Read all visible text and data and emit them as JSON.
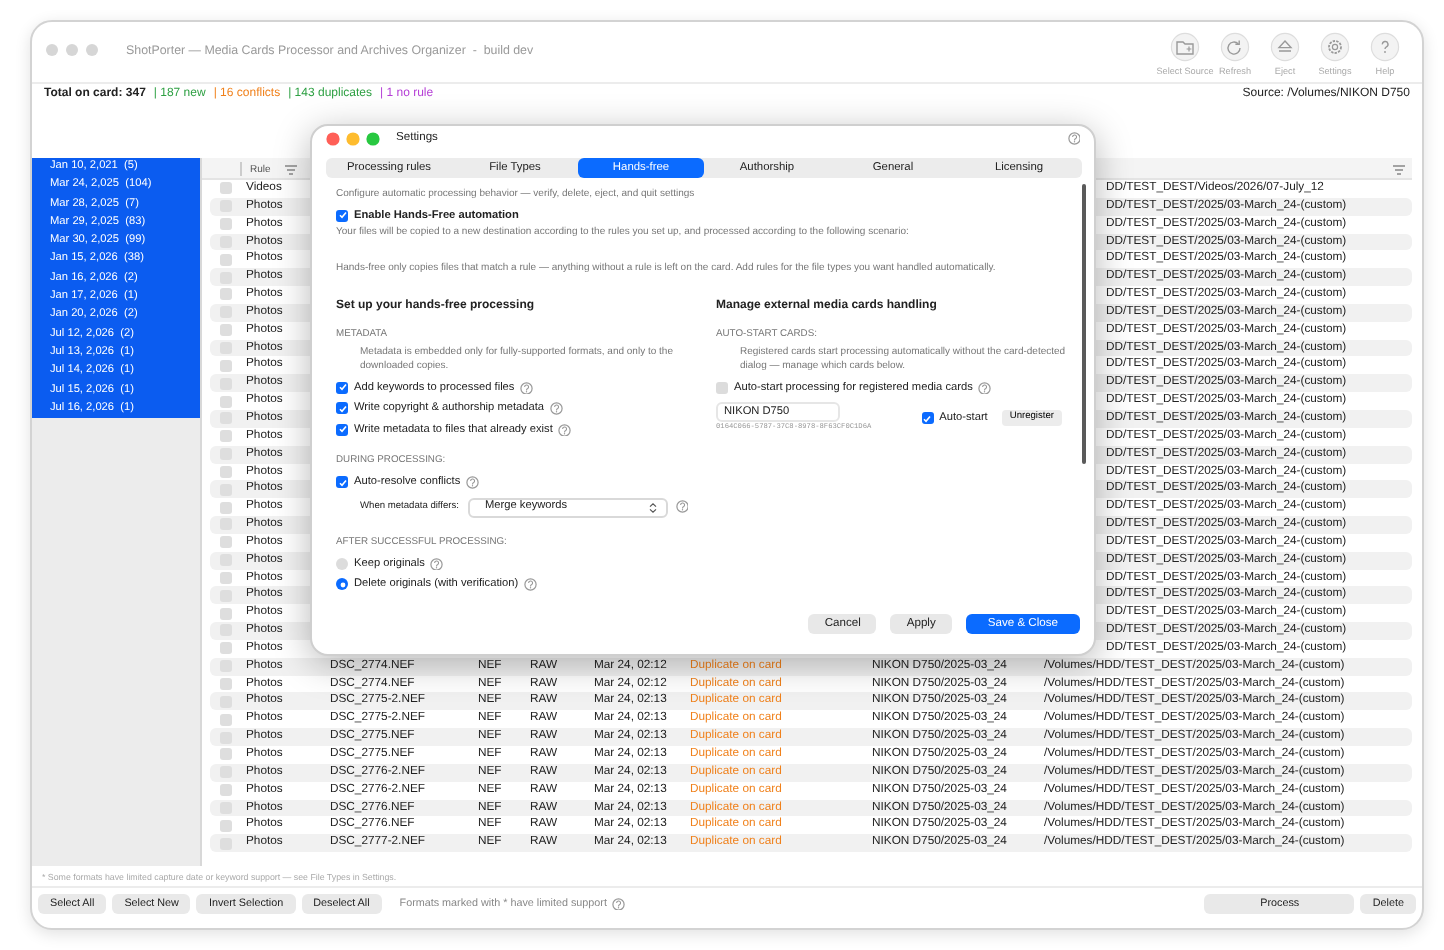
{
  "window": {
    "title": "ShotPorter — Media Cards Processor and Archives Organizer  -  build dev"
  },
  "toolbar": [
    {
      "label": "Select Source"
    },
    {
      "label": "Refresh"
    },
    {
      "label": "Eject"
    },
    {
      "label": "Settings"
    },
    {
      "label": "Help"
    }
  ],
  "summary": {
    "total": "Total on card: 347",
    "counts": [
      {
        "text": "| 187 new",
        "color": "#2ea043"
      },
      {
        "text": "| 16 conflicts",
        "color": "#f0801a"
      },
      {
        "text": "| 143 duplicates",
        "color": "#2ea043"
      },
      {
        "text": "| 1 no rule",
        "color": "#b53fd6"
      }
    ],
    "source": "Source: /Volumes/NIKON D750"
  },
  "sidebar": {
    "items": [
      {
        "label": "Jan 10, 2,021  (5)",
        "selected": true
      },
      {
        "label": "Mar 24, 2,025  (104)",
        "selected": true
      },
      {
        "label": "Mar 28, 2,025  (7)",
        "selected": true
      },
      {
        "label": "Mar 29, 2,025  (83)",
        "selected": true
      },
      {
        "label": "Mar 30, 2,025  (99)",
        "selected": true
      },
      {
        "label": "Jan 15, 2,026  (38)",
        "selected": true
      },
      {
        "label": "Jan 16, 2,026  (2)",
        "selected": true
      },
      {
        "label": "Jan 17, 2,026  (1)",
        "selected": true
      },
      {
        "label": "Jan 20, 2,026  (2)",
        "selected": true
      },
      {
        "label": "Jul 12, 2,026  (2)",
        "selected": true
      },
      {
        "label": "Jul 13, 2,026  (1)",
        "selected": true
      },
      {
        "label": "Jul 14, 2,026  (1)",
        "selected": true
      },
      {
        "label": "Jul 15, 2,026  (1)",
        "selected": true
      },
      {
        "label": "Jul 16, 2,026  (1)",
        "selected": true
      }
    ]
  },
  "table": {
    "columns": [
      {
        "label": "Rule"
      }
    ],
    "rows": [
      {
        "kind": "covered",
        "checked": false,
        "rule": "Videos",
        "destination": "DD/TEST_DEST/Videos/2026/07-July_12"
      },
      {
        "kind": "covered",
        "checked": false,
        "rule": "Photos",
        "destination": "DD/TEST_DEST/2025/03-March_24-(custom)"
      },
      {
        "kind": "covered",
        "checked": false,
        "rule": "Photos",
        "destination": "DD/TEST_DEST/2025/03-March_24-(custom)"
      },
      {
        "kind": "covered",
        "checked": false,
        "rule": "Photos",
        "destination": "DD/TEST_DEST/2025/03-March_24-(custom)"
      },
      {
        "kind": "covered",
        "checked": false,
        "rule": "Photos",
        "destination": "DD/TEST_DEST/2025/03-March_24-(custom)"
      },
      {
        "kind": "covered",
        "checked": false,
        "rule": "Photos",
        "destination": "DD/TEST_DEST/2025/03-March_24-(custom)"
      },
      {
        "kind": "covered",
        "checked": false,
        "rule": "Photos",
        "destination": "DD/TEST_DEST/2025/03-March_24-(custom)"
      },
      {
        "kind": "covered",
        "checked": false,
        "rule": "Photos",
        "destination": "DD/TEST_DEST/2025/03-March_24-(custom)"
      },
      {
        "kind": "covered",
        "checked": false,
        "rule": "Photos",
        "destination": "DD/TEST_DEST/2025/03-March_24-(custom)"
      },
      {
        "kind": "covered",
        "checked": false,
        "rule": "Photos",
        "destination": "DD/TEST_DEST/2025/03-March_24-(custom)"
      },
      {
        "kind": "covered",
        "checked": false,
        "rule": "Photos",
        "destination": "DD/TEST_DEST/2025/03-March_24-(custom)"
      },
      {
        "kind": "covered",
        "checked": false,
        "rule": "Photos",
        "destination": "DD/TEST_DEST/2025/03-March_24-(custom)"
      },
      {
        "kind": "covered",
        "checked": false,
        "rule": "Photos",
        "destination": "DD/TEST_DEST/2025/03-March_24-(custom)"
      },
      {
        "kind": "covered",
        "checked": false,
        "rule": "Photos",
        "destination": "DD/TEST_DEST/2025/03-March_24-(custom)"
      },
      {
        "kind": "covered",
        "checked": false,
        "rule": "Photos",
        "destination": "DD/TEST_DEST/2025/03-March_24-(custom)"
      },
      {
        "kind": "covered",
        "checked": false,
        "rule": "Photos",
        "destination": "DD/TEST_DEST/2025/03-March_24-(custom)"
      },
      {
        "kind": "covered",
        "checked": false,
        "rule": "Photos",
        "destination": "DD/TEST_DEST/2025/03-March_24-(custom)"
      },
      {
        "kind": "covered",
        "checked": false,
        "rule": "Photos",
        "destination": "DD/TEST_DEST/2025/03-March_24-(custom)"
      },
      {
        "kind": "covered",
        "checked": false,
        "rule": "Photos",
        "destination": "DD/TEST_DEST/2025/03-March_24-(custom)"
      },
      {
        "kind": "covered",
        "checked": false,
        "rule": "Photos",
        "destination": "DD/TEST_DEST/2025/03-March_24-(custom)"
      },
      {
        "kind": "covered",
        "checked": false,
        "rule": "Photos",
        "destination": "DD/TEST_DEST/2025/03-March_24-(custom)"
      },
      {
        "kind": "covered",
        "checked": false,
        "rule": "Photos",
        "destination": "DD/TEST_DEST/2025/03-March_24-(custom)"
      },
      {
        "kind": "covered",
        "checked": false,
        "rule": "Photos",
        "destination": "DD/TEST_DEST/2025/03-March_24-(custom)"
      },
      {
        "kind": "covered",
        "checked": false,
        "rule": "Photos",
        "destination": "DD/TEST_DEST/2025/03-March_24-(custom)"
      },
      {
        "kind": "covered",
        "checked": false,
        "rule": "Photos",
        "destination": "DD/TEST_DEST/2025/03-March_24-(custom)"
      },
      {
        "kind": "covered",
        "checked": false,
        "rule": "Photos",
        "destination": "DD/TEST_DEST/2025/03-March_24-(custom)"
      },
      {
        "kind": "covered",
        "checked": false,
        "rule": "Photos",
        "destination": "DD/TEST_DEST/2025/03-March_24-(custom)"
      },
      {
        "kind": "full",
        "checked": false,
        "rule": "Photos",
        "file": "DSC_2774.NEF",
        "ext": "NEF",
        "type": "RAW",
        "date": "Mar 24, 02:12",
        "status": "Duplicate on card",
        "folder": "NIKON D750/2025-03_24",
        "destination": "/Volumes/HDD/TEST_DEST/2025/03-March_24-(custom)"
      },
      {
        "kind": "full",
        "checked": false,
        "rule": "Photos",
        "file": "DSC_2774.NEF",
        "ext": "NEF",
        "type": "RAW",
        "date": "Mar 24, 02:12",
        "status": "Duplicate on card",
        "folder": "NIKON D750/2025-03_24",
        "destination": "/Volumes/HDD/TEST_DEST/2025/03-March_24-(custom)"
      },
      {
        "kind": "full",
        "checked": false,
        "rule": "Photos",
        "file": "DSC_2775-2.NEF",
        "ext": "NEF",
        "type": "RAW",
        "date": "Mar 24, 02:13",
        "status": "Duplicate on card",
        "folder": "NIKON D750/2025-03_24",
        "destination": "/Volumes/HDD/TEST_DEST/2025/03-March_24-(custom)"
      },
      {
        "kind": "full",
        "checked": false,
        "rule": "Photos",
        "file": "DSC_2775-2.NEF",
        "ext": "NEF",
        "type": "RAW",
        "date": "Mar 24, 02:13",
        "status": "Duplicate on card",
        "folder": "NIKON D750/2025-03_24",
        "destination": "/Volumes/HDD/TEST_DEST/2025/03-March_24-(custom)"
      },
      {
        "kind": "full",
        "checked": false,
        "rule": "Photos",
        "file": "DSC_2775.NEF",
        "ext": "NEF",
        "type": "RAW",
        "date": "Mar 24, 02:13",
        "status": "Duplicate on card",
        "folder": "NIKON D750/2025-03_24",
        "destination": "/Volumes/HDD/TEST_DEST/2025/03-March_24-(custom)"
      },
      {
        "kind": "full",
        "checked": false,
        "rule": "Photos",
        "file": "DSC_2775.NEF",
        "ext": "NEF",
        "type": "RAW",
        "date": "Mar 24, 02:13",
        "status": "Duplicate on card",
        "folder": "NIKON D750/2025-03_24",
        "destination": "/Volumes/HDD/TEST_DEST/2025/03-March_24-(custom)"
      },
      {
        "kind": "full",
        "checked": false,
        "rule": "Photos",
        "file": "DSC_2776-2.NEF",
        "ext": "NEF",
        "type": "RAW",
        "date": "Mar 24, 02:13",
        "status": "Duplicate on card",
        "folder": "NIKON D750/2025-03_24",
        "destination": "/Volumes/HDD/TEST_DEST/2025/03-March_24-(custom)"
      },
      {
        "kind": "full",
        "checked": false,
        "rule": "Photos",
        "file": "DSC_2776-2.NEF",
        "ext": "NEF",
        "type": "RAW",
        "date": "Mar 24, 02:13",
        "status": "Duplicate on card",
        "folder": "NIKON D750/2025-03_24",
        "destination": "/Volumes/HDD/TEST_DEST/2025/03-March_24-(custom)"
      },
      {
        "kind": "full",
        "checked": false,
        "rule": "Photos",
        "file": "DSC_2776.NEF",
        "ext": "NEF",
        "type": "RAW",
        "date": "Mar 24, 02:13",
        "status": "Duplicate on card",
        "folder": "NIKON D750/2025-03_24",
        "destination": "/Volumes/HDD/TEST_DEST/2025/03-March_24-(custom)"
      },
      {
        "kind": "full",
        "checked": false,
        "rule": "Photos",
        "file": "DSC_2776.NEF",
        "ext": "NEF",
        "type": "RAW",
        "date": "Mar 24, 02:13",
        "status": "Duplicate on card",
        "folder": "NIKON D750/2025-03_24",
        "destination": "/Volumes/HDD/TEST_DEST/2025/03-March_24-(custom)"
      },
      {
        "kind": "full",
        "checked": false,
        "rule": "Photos",
        "file": "DSC_2777-2.NEF",
        "ext": "NEF",
        "type": "RAW",
        "date": "Mar 24, 02:13",
        "status": "Duplicate on card",
        "folder": "NIKON D750/2025-03_24",
        "destination": "/Volumes/HDD/TEST_DEST/2025/03-March_24-(custom)"
      }
    ]
  },
  "footnote": "* Some formats have limited capture date or keyword support — see File Types in Settings.",
  "bottom_bar": {
    "left_buttons": [
      "Select All",
      "Select New",
      "Invert Selection",
      "Deselect All"
    ],
    "note": "Formats marked with * have limited support",
    "right_buttons": [
      "Process",
      "Delete"
    ]
  },
  "dialog": {
    "title": "Settings",
    "tabs": [
      {
        "label": "Processing rules",
        "selected": false
      },
      {
        "label": "File Types",
        "selected": false
      },
      {
        "label": "Hands-free",
        "selected": true
      },
      {
        "label": "Authorship",
        "selected": false
      },
      {
        "label": "General",
        "selected": false
      },
      {
        "label": "Licensing",
        "selected": false
      }
    ],
    "intro": "Configure automatic processing behavior — verify, delete, eject, and quit settings",
    "enable": {
      "label": "Enable Hands-Free automation",
      "checked": true
    },
    "notes": [
      "Your files will be copied to a new destination according to the rules you set up, and processed according to the following scenario:",
      "Hands-free only copies files that match a rule — anything without a rule is left on the card. Add rules for the file types you want handled automatically."
    ],
    "left": {
      "heading": "Set up your hands-free processing",
      "sections": [
        {
          "heading": "METADATA",
          "items": [
            {
              "kind": "note",
              "text": "Metadata is embedded only for fully-supported formats, and only to the downloaded copies."
            },
            {
              "kind": "checkbox",
              "label": "Add keywords to processed files",
              "checked": true
            },
            {
              "kind": "checkbox",
              "label": "Write copyright & authorship metadata",
              "checked": true
            },
            {
              "kind": "checkbox",
              "label": "Write metadata to files that already exist",
              "checked": true
            }
          ]
        },
        {
          "heading": "DURING PROCESSING:",
          "items": [
            {
              "kind": "checkbox",
              "label": "Auto-resolve conflicts",
              "checked": true
            },
            {
              "kind": "select",
              "label": "When metadata differs:",
              "value": "Merge keywords"
            }
          ]
        },
        {
          "heading": "AFTER SUCCESSFUL PROCESSING:",
          "items": [
            {
              "kind": "radio",
              "label": "Keep originals",
              "selected": false
            },
            {
              "kind": "radio",
              "label": "Delete originals (with verification)",
              "selected": true
            }
          ]
        }
      ]
    },
    "right": {
      "heading": "Manage external media cards handling",
      "sections": [
        {
          "heading": "AUTO-START CARDS:",
          "items": [
            {
              "kind": "note",
              "text": "Registered cards start processing automatically without the card-detected dialog — manage which cards below."
            },
            {
              "kind": "checkbox",
              "label": "Auto-start processing for registered media cards",
              "checked": false
            },
            {
              "kind": "card",
              "name": "NIKON D750",
              "uuid": "0164C066-5787-37C8-8978-8F63CF0C1D6A",
              "auto_start": {
                "label": "Auto-start",
                "checked": true
              },
              "button": "Unregister"
            }
          ]
        }
      ]
    },
    "buttons": [
      {
        "label": "Cancel",
        "primary": false
      },
      {
        "label": "Apply",
        "primary": false
      },
      {
        "label": "Save & Close",
        "primary": true
      }
    ]
  }
}
